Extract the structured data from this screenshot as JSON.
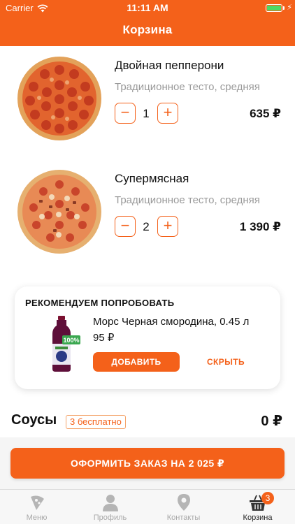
{
  "status_bar": {
    "carrier": "Carrier",
    "time": "11:11 AM"
  },
  "nav": {
    "title": "Корзина"
  },
  "cart": {
    "items": [
      {
        "name": "Двойная пепперони",
        "description": "Традиционное тесто, средняя",
        "quantity": "1",
        "minus": "−",
        "plus": "+",
        "price": "635 ₽"
      },
      {
        "name": "Супермясная",
        "description": "Традиционное тесто, средняя",
        "quantity": "2",
        "minus": "−",
        "plus": "+",
        "price": "1 390 ₽"
      }
    ]
  },
  "recommendation": {
    "title": "РЕКОМЕНДУЕМ ПОПРОБОВАТЬ",
    "product_name": "Морс Черная смородина, 0.45 л",
    "product_price": "95 ₽",
    "bottle_badge": "100%",
    "add_label": "ДОБАВИТЬ",
    "hide_label": "СКРЫТЬ"
  },
  "sauces": {
    "title": "Соусы",
    "badge": "3 бесплатно",
    "price": "0 ₽"
  },
  "checkout": {
    "label": "ОФОРМИТЬ ЗАКАЗ НА 2 025 ₽"
  },
  "tabbar": {
    "tabs": [
      {
        "label": "Меню",
        "icon": "pizza-slice-icon"
      },
      {
        "label": "Профиль",
        "icon": "person-icon"
      },
      {
        "label": "Контакты",
        "icon": "location-pin-icon"
      },
      {
        "label": "Корзина",
        "icon": "basket-icon",
        "badge": "3"
      }
    ]
  },
  "colors": {
    "accent": "#f4611a",
    "muted_text": "#9a9a9a",
    "tab_inactive": "#a8a8a8"
  }
}
